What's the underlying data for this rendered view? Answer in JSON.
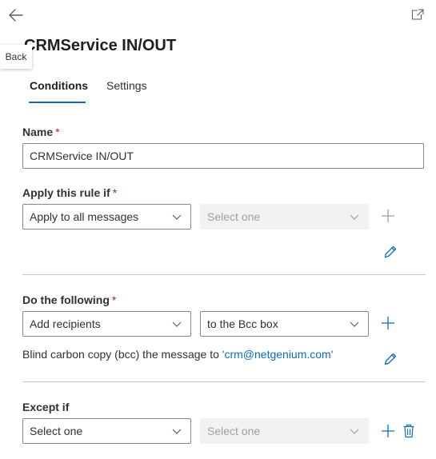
{
  "header": {
    "back_tooltip": "Back",
    "title": "CRMService IN/OUT"
  },
  "tabs": [
    {
      "label": "Conditions",
      "active": true
    },
    {
      "label": "Settings",
      "active": false
    }
  ],
  "name_field": {
    "label": "Name",
    "required_mark": "*",
    "value": "CRMService IN/OUT"
  },
  "apply_rule": {
    "label": "Apply this rule if",
    "required_mark": "*",
    "condition": "Apply to all messages",
    "sub_condition": "Select one"
  },
  "do_following": {
    "label": "Do the following",
    "required_mark": "*",
    "action": "Add recipients",
    "sub_action": "to the Bcc box",
    "description_prefix": "Blind carbon copy (bcc) the message to ",
    "description_link": "'crm@netgenium.com'"
  },
  "except_if": {
    "label": "Except if",
    "condition": "Select one",
    "sub_condition": "Select one"
  },
  "icons": {
    "back": "arrow-left-icon",
    "popout": "open-in-new-window-icon",
    "add": "plus-icon",
    "edit": "pencil-icon",
    "delete": "trash-icon",
    "dropdown": "chevron-down-icon"
  },
  "colors": {
    "accent": "#0f6cbd",
    "required": "#a4262c",
    "disabled_bg": "#f3f2f1"
  }
}
